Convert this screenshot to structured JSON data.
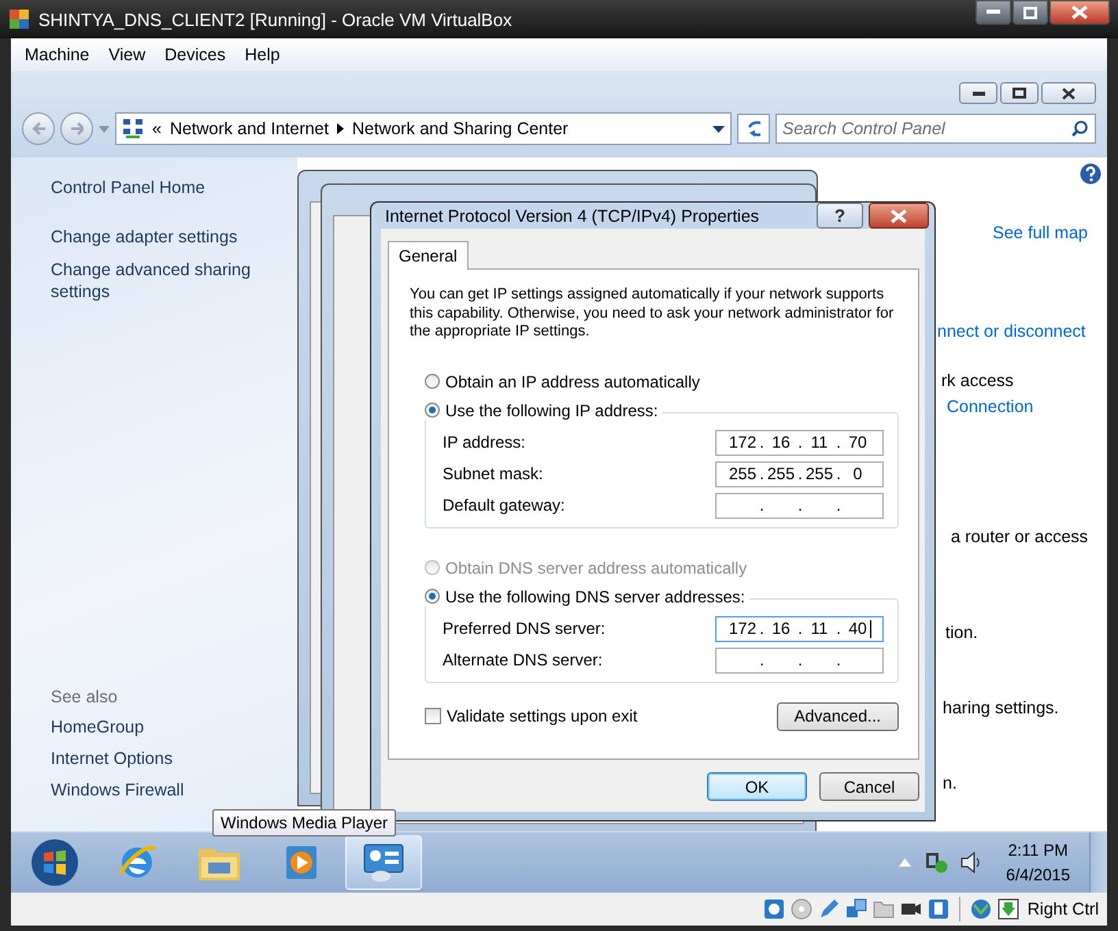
{
  "window": {
    "title": "SHINTYA_DNS_CLIENT2 [Running] - Oracle VM VirtualBox"
  },
  "menu": [
    "Machine",
    "View",
    "Devices",
    "Help"
  ],
  "explorer": {
    "chevron": "«",
    "breadcrumb": [
      "Network and Internet",
      "Network and Sharing Center"
    ],
    "search": {
      "placeholder": "Search Control Panel"
    }
  },
  "sidebar": {
    "items": [
      "Control Panel Home",
      "Change adapter settings",
      "Change advanced sharing settings"
    ],
    "see_also_title": "See also",
    "see_also": [
      "HomeGroup",
      "Internet Options",
      "Windows Firewall"
    ]
  },
  "main_pane": [
    {
      "kind": "link",
      "text": "See full map"
    },
    {
      "kind": "link",
      "text": "nnect or disconnect"
    },
    {
      "kind": "text",
      "text": "rk access"
    },
    {
      "kind": "link",
      "text": "Connection"
    },
    {
      "kind": "text",
      "text": "a router or access"
    },
    {
      "kind": "text",
      "text": "tion."
    },
    {
      "kind": "text",
      "text": "haring settings."
    },
    {
      "kind": "text",
      "text": "n."
    }
  ],
  "dialog": {
    "title": "Internet Protocol Version 4 (TCP/IPv4) Properties",
    "help": "?",
    "tabs": [
      {
        "label": "General",
        "selected": true
      }
    ],
    "description": "You can get IP settings assigned automatically if your network supports this capability. Otherwise, you need to ask your network administrator for the appropriate IP settings.",
    "octet_separator": ".",
    "ip_options": [
      {
        "label": "Obtain an IP address automatically",
        "selected": false,
        "disabled": false
      },
      {
        "label": "Use the following IP address:",
        "selected": true,
        "disabled": false
      }
    ],
    "ip_fields": [
      {
        "label": "IP address:",
        "octets": [
          "172",
          "16",
          "11",
          "70"
        ],
        "focused": false
      },
      {
        "label": "Subnet mask:",
        "octets": [
          "255",
          "255",
          "255",
          "0"
        ],
        "focused": false
      },
      {
        "label": "Default gateway:",
        "focused": false
      }
    ],
    "dns_options": [
      {
        "label": "Obtain DNS server address automatically",
        "selected": false,
        "disabled": true
      },
      {
        "label": "Use the following DNS server addresses:",
        "selected": true,
        "disabled": false
      }
    ],
    "dns_fields": [
      {
        "label": "Preferred DNS server:",
        "octets": [
          "172",
          "16",
          "11",
          "40"
        ],
        "focused": true
      },
      {
        "label": "Alternate DNS server:",
        "focused": false
      }
    ],
    "validate": {
      "label": "Validate settings upon exit",
      "checked": false
    },
    "advanced": "Advanced...",
    "buttons": [
      {
        "label": "OK",
        "default": true
      },
      {
        "label": "Cancel",
        "default": false
      }
    ]
  },
  "tooltip": "Windows Media Player",
  "taskbar": {
    "items": [
      {
        "kind": "ie",
        "selected": false
      },
      {
        "kind": "folder",
        "selected": false
      },
      {
        "kind": "media",
        "selected": false
      },
      {
        "kind": "control",
        "selected": true
      }
    ],
    "time": "2:11 PM",
    "date": "6/4/2015"
  },
  "status_bar": {
    "host_key": "Right Ctrl"
  }
}
